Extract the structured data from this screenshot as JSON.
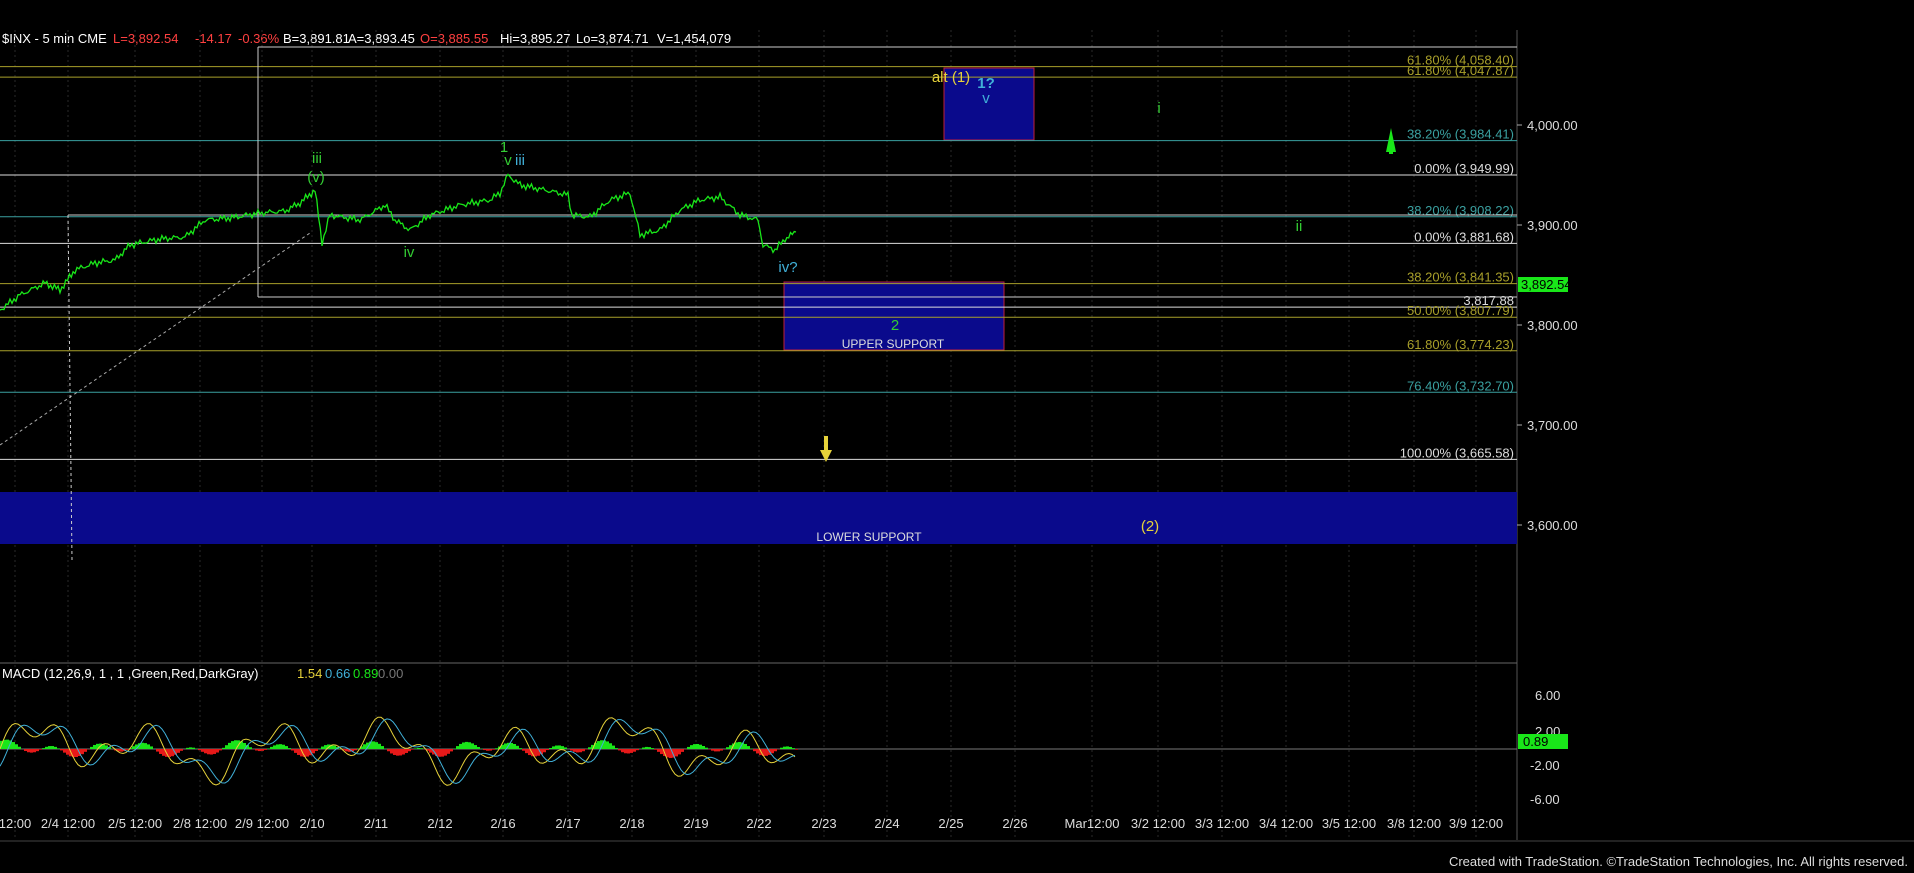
{
  "header": {
    "symbol": "$INX - 5 min  CME",
    "last": "L=3,892.54",
    "change": "-14.17",
    "pct": "-0.36%",
    "bid": "B=3,891.81",
    "ask": "A=3,893.45",
    "open": "O=3,885.55",
    "high": "Hi=3,895.27",
    "low": "Lo=3,874.71",
    "volume": "V=1,454,079"
  },
  "colors": {
    "price": "#19e619",
    "wave_green": "#33cc33",
    "wave_cyan": "#40b0d8",
    "wave_yellow": "#e6d23a",
    "support_box": "#0a0a8c",
    "support_border": "#c0203a",
    "fib_olive": "#a89f2a",
    "fib_teal": "#3aa0a0",
    "macd_pos": "#19e619",
    "macd_neg": "#e61919"
  },
  "macd": {
    "label": "MACD (12,26,9, 1 , 1 ,Green,Red,DarkGray)",
    "v1": "1.54",
    "v2": "0.66",
    "v3": "0.89",
    "v4": "0.00",
    "ticks": [
      "6.00",
      "2.00",
      "-2.00",
      "-6.00"
    ],
    "last_tag": "0.89"
  },
  "footer": "Created with TradeStation. ©TradeStation Technologies, Inc. All rights reserved.",
  "chart_data": {
    "type": "line",
    "title": "$INX - 5 min",
    "price_ticks": [
      "4,000.00",
      "3,900.00",
      "3,800.00",
      "3,700.00",
      "3,600.00"
    ],
    "price_ticks_values": [
      4000,
      3900,
      3800,
      3700,
      3600
    ],
    "x_ticks": [
      "12:00",
      "2/4 12:00",
      "2/5 12:00",
      "2/8 12:00",
      "2/9 12:00",
      "2/10",
      "2/11",
      "2/12",
      "2/16",
      "2/17",
      "2/18",
      "2/19",
      "2/22",
      "2/23",
      "2/24",
      "2/25",
      "2/26",
      "Mar12:00",
      "3/2 12:00",
      "3/3 12:00",
      "3/4 12:00",
      "3/5 12:00",
      "3/8 12:00",
      "3/9 12:00"
    ],
    "last_price_tag": "3,892.54",
    "ylim": [
      3580,
      4080
    ],
    "price_series": [
      {
        "x": 0,
        "y": 3815
      },
      {
        "x": 20,
        "y": 3830
      },
      {
        "x": 45,
        "y": 3842
      },
      {
        "x": 60,
        "y": 3835
      },
      {
        "x": 75,
        "y": 3855
      },
      {
        "x": 95,
        "y": 3862
      },
      {
        "x": 115,
        "y": 3865
      },
      {
        "x": 130,
        "y": 3880
      },
      {
        "x": 160,
        "y": 3886
      },
      {
        "x": 185,
        "y": 3888
      },
      {
        "x": 205,
        "y": 3905
      },
      {
        "x": 230,
        "y": 3907
      },
      {
        "x": 260,
        "y": 3912
      },
      {
        "x": 285,
        "y": 3914
      },
      {
        "x": 300,
        "y": 3922
      },
      {
        "x": 315,
        "y": 3935
      },
      {
        "x": 322,
        "y": 3882
      },
      {
        "x": 330,
        "y": 3910
      },
      {
        "x": 360,
        "y": 3905
      },
      {
        "x": 385,
        "y": 3920
      },
      {
        "x": 395,
        "y": 3905
      },
      {
        "x": 410,
        "y": 3895
      },
      {
        "x": 430,
        "y": 3910
      },
      {
        "x": 460,
        "y": 3920
      },
      {
        "x": 490,
        "y": 3925
      },
      {
        "x": 500,
        "y": 3932
      },
      {
        "x": 508,
        "y": 3950
      },
      {
        "x": 520,
        "y": 3940
      },
      {
        "x": 545,
        "y": 3935
      },
      {
        "x": 568,
        "y": 3930
      },
      {
        "x": 572,
        "y": 3910
      },
      {
        "x": 590,
        "y": 3908
      },
      {
        "x": 610,
        "y": 3925
      },
      {
        "x": 630,
        "y": 3932
      },
      {
        "x": 640,
        "y": 3890
      },
      {
        "x": 660,
        "y": 3895
      },
      {
        "x": 680,
        "y": 3915
      },
      {
        "x": 700,
        "y": 3925
      },
      {
        "x": 720,
        "y": 3928
      },
      {
        "x": 740,
        "y": 3910
      },
      {
        "x": 758,
        "y": 3905
      },
      {
        "x": 763,
        "y": 3880
      },
      {
        "x": 775,
        "y": 3875
      },
      {
        "x": 785,
        "y": 3886
      },
      {
        "x": 796,
        "y": 3893
      }
    ],
    "fib_levels": [
      {
        "label": "61.80% (4,058.40)",
        "value": 4058.4,
        "color": "olive"
      },
      {
        "label": "61.80% (4,047.87)",
        "value": 4047.87,
        "color": "olive"
      },
      {
        "label": "38.20% (3,984.41)",
        "value": 3984.41,
        "color": "teal"
      },
      {
        "label": "0.00% (3,949.99)",
        "value": 3949.99,
        "color": "white"
      },
      {
        "label": "38.20% (3,908.22)",
        "value": 3908.22,
        "color": "teal"
      },
      {
        "label": "0.00% (3,881.68)",
        "value": 3881.68,
        "color": "white"
      },
      {
        "label": "38.20% (3,841.35)",
        "value": 3841.35,
        "color": "olive"
      },
      {
        "label": "3,817.88",
        "value": 3817.88,
        "color": "white"
      },
      {
        "label": "50.00% (3,807.79)",
        "value": 3807.79,
        "color": "olive"
      },
      {
        "label": "61.80% (3,774.23)",
        "value": 3774.23,
        "color": "olive"
      },
      {
        "label": "76.40% (3,732.70)",
        "value": 3732.7,
        "color": "teal"
      },
      {
        "label": "100.00% (3,665.58)",
        "value": 3665.58,
        "color": "white"
      }
    ],
    "zones": [
      {
        "label": "UPPER SUPPORT",
        "top": 3843,
        "bottom": 3775,
        "x0": 784,
        "x1": 1004
      },
      {
        "label": "LOWER SUPPORT",
        "top": 3633,
        "bottom": 3581,
        "x0": 0,
        "x1": 1517
      },
      {
        "label": "",
        "top": 4057,
        "bottom": 3985,
        "x0": 944,
        "x1": 1034
      }
    ],
    "wave_labels": [
      {
        "text": "iii",
        "x": 317,
        "y": 3962,
        "color": "green"
      },
      {
        "text": "(v)",
        "x": 316,
        "y": 3943,
        "color": "green"
      },
      {
        "text": "iv",
        "x": 409,
        "y": 3868,
        "color": "green"
      },
      {
        "text": "1",
        "x": 504,
        "y": 3973,
        "color": "green"
      },
      {
        "text": "v",
        "x": 508,
        "y": 3960,
        "color": "green"
      },
      {
        "text": "iii",
        "x": 520,
        "y": 3960,
        "color": "cyan"
      },
      {
        "text": "iv?",
        "x": 788,
        "y": 3853,
        "color": "cyan"
      },
      {
        "text": "2",
        "x": 895,
        "y": 3795,
        "color": "green"
      },
      {
        "text": "alt (1)",
        "x": 951,
        "y": 4043,
        "color": "yellow"
      },
      {
        "text": "1?",
        "x": 986,
        "y": 4037,
        "color": "cyan"
      },
      {
        "text": "v",
        "x": 986,
        "y": 4022,
        "color": "cyan"
      },
      {
        "text": "i",
        "x": 1159,
        "y": 4012,
        "color": "green"
      },
      {
        "text": "ii",
        "x": 1299,
        "y": 3894,
        "color": "green"
      },
      {
        "text": "(2)",
        "x": 1150,
        "y": 3594,
        "color": "yellow"
      }
    ]
  }
}
